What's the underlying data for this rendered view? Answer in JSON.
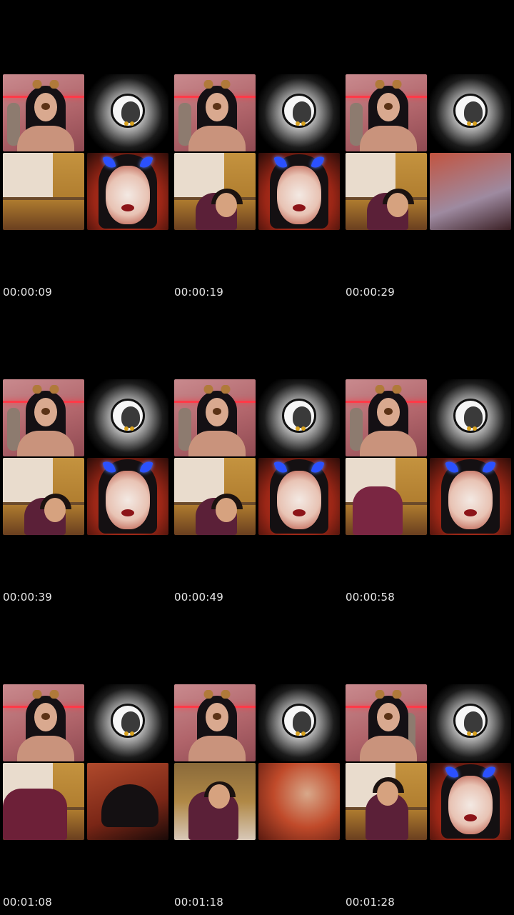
{
  "cells": [
    {
      "timestamp": "00:00:09"
    },
    {
      "timestamp": "00:00:19"
    },
    {
      "timestamp": "00:00:29"
    },
    {
      "timestamp": "00:00:39"
    },
    {
      "timestamp": "00:00:49"
    },
    {
      "timestamp": "00:00:58"
    },
    {
      "timestamp": "00:01:08"
    },
    {
      "timestamp": "00:01:18"
    },
    {
      "timestamp": "00:01:28"
    }
  ],
  "colors": {
    "background": "#000000",
    "timestamp_text": "#e8e8e8",
    "neon_red": "#ff3a48",
    "horn_blue": "#2b51ff"
  }
}
